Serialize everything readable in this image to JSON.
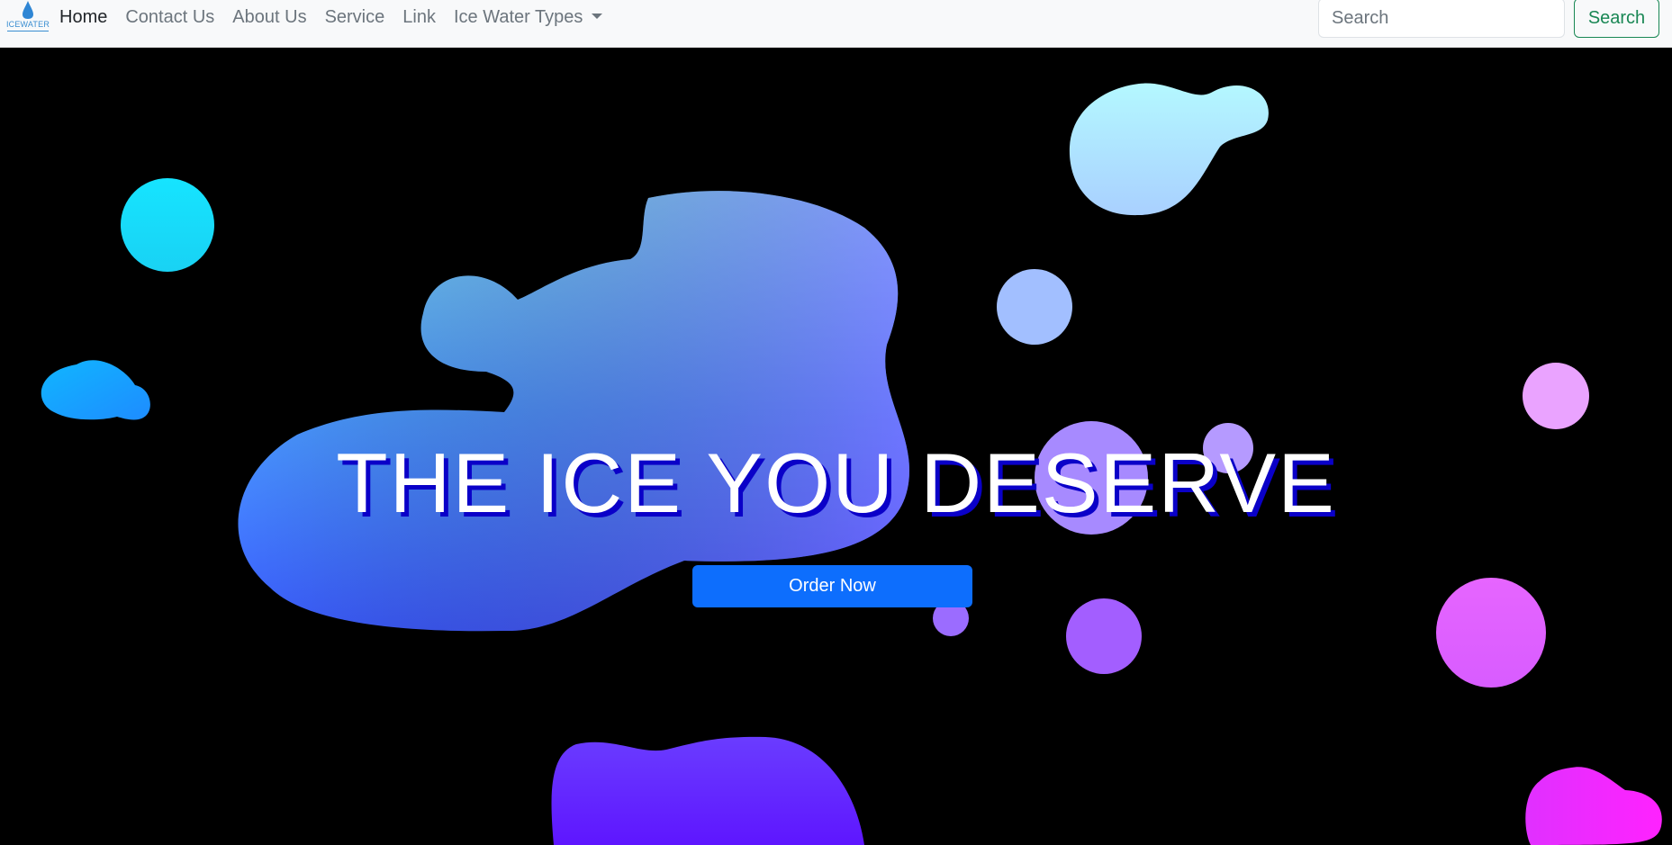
{
  "brand": {
    "name": "ICEWATER",
    "icon": "water-drop-icon"
  },
  "nav": {
    "items": [
      {
        "label": "Home",
        "active": true
      },
      {
        "label": "Contact Us",
        "active": false
      },
      {
        "label": "About Us",
        "active": false
      },
      {
        "label": "Service",
        "active": false
      },
      {
        "label": "Link",
        "active": false
      },
      {
        "label": "Ice Water Types",
        "active": false,
        "dropdown": true
      }
    ]
  },
  "search": {
    "placeholder": "Search",
    "button_label": "Search"
  },
  "hero": {
    "title": "THE ICE YOU DESERVE",
    "cta_label": "Order Now"
  },
  "colors": {
    "primary": "#0d6efd",
    "success": "#198754",
    "title_shadow": "#0a00c8",
    "navbar_bg": "#f8f9fa"
  }
}
